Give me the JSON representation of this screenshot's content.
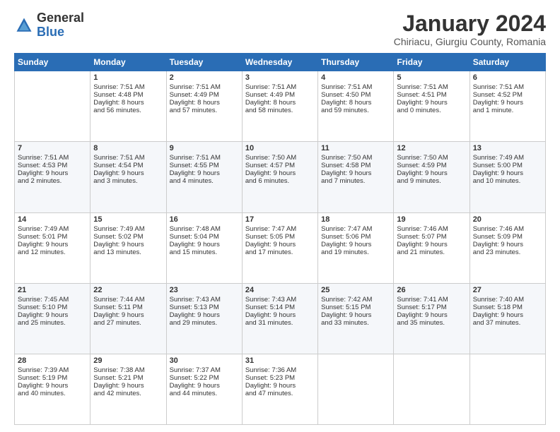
{
  "header": {
    "logo_general": "General",
    "logo_blue": "Blue",
    "main_title": "January 2024",
    "subtitle": "Chiriacu, Giurgiu County, Romania"
  },
  "weekdays": [
    "Sunday",
    "Monday",
    "Tuesday",
    "Wednesday",
    "Thursday",
    "Friday",
    "Saturday"
  ],
  "weeks": [
    [
      {
        "day": "",
        "lines": []
      },
      {
        "day": "1",
        "lines": [
          "Sunrise: 7:51 AM",
          "Sunset: 4:48 PM",
          "Daylight: 8 hours",
          "and 56 minutes."
        ]
      },
      {
        "day": "2",
        "lines": [
          "Sunrise: 7:51 AM",
          "Sunset: 4:49 PM",
          "Daylight: 8 hours",
          "and 57 minutes."
        ]
      },
      {
        "day": "3",
        "lines": [
          "Sunrise: 7:51 AM",
          "Sunset: 4:49 PM",
          "Daylight: 8 hours",
          "and 58 minutes."
        ]
      },
      {
        "day": "4",
        "lines": [
          "Sunrise: 7:51 AM",
          "Sunset: 4:50 PM",
          "Daylight: 8 hours",
          "and 59 minutes."
        ]
      },
      {
        "day": "5",
        "lines": [
          "Sunrise: 7:51 AM",
          "Sunset: 4:51 PM",
          "Daylight: 9 hours",
          "and 0 minutes."
        ]
      },
      {
        "day": "6",
        "lines": [
          "Sunrise: 7:51 AM",
          "Sunset: 4:52 PM",
          "Daylight: 9 hours",
          "and 1 minute."
        ]
      }
    ],
    [
      {
        "day": "7",
        "lines": [
          "Sunrise: 7:51 AM",
          "Sunset: 4:53 PM",
          "Daylight: 9 hours",
          "and 2 minutes."
        ]
      },
      {
        "day": "8",
        "lines": [
          "Sunrise: 7:51 AM",
          "Sunset: 4:54 PM",
          "Daylight: 9 hours",
          "and 3 minutes."
        ]
      },
      {
        "day": "9",
        "lines": [
          "Sunrise: 7:51 AM",
          "Sunset: 4:55 PM",
          "Daylight: 9 hours",
          "and 4 minutes."
        ]
      },
      {
        "day": "10",
        "lines": [
          "Sunrise: 7:50 AM",
          "Sunset: 4:57 PM",
          "Daylight: 9 hours",
          "and 6 minutes."
        ]
      },
      {
        "day": "11",
        "lines": [
          "Sunrise: 7:50 AM",
          "Sunset: 4:58 PM",
          "Daylight: 9 hours",
          "and 7 minutes."
        ]
      },
      {
        "day": "12",
        "lines": [
          "Sunrise: 7:50 AM",
          "Sunset: 4:59 PM",
          "Daylight: 9 hours",
          "and 9 minutes."
        ]
      },
      {
        "day": "13",
        "lines": [
          "Sunrise: 7:49 AM",
          "Sunset: 5:00 PM",
          "Daylight: 9 hours",
          "and 10 minutes."
        ]
      }
    ],
    [
      {
        "day": "14",
        "lines": [
          "Sunrise: 7:49 AM",
          "Sunset: 5:01 PM",
          "Daylight: 9 hours",
          "and 12 minutes."
        ]
      },
      {
        "day": "15",
        "lines": [
          "Sunrise: 7:49 AM",
          "Sunset: 5:02 PM",
          "Daylight: 9 hours",
          "and 13 minutes."
        ]
      },
      {
        "day": "16",
        "lines": [
          "Sunrise: 7:48 AM",
          "Sunset: 5:04 PM",
          "Daylight: 9 hours",
          "and 15 minutes."
        ]
      },
      {
        "day": "17",
        "lines": [
          "Sunrise: 7:47 AM",
          "Sunset: 5:05 PM",
          "Daylight: 9 hours",
          "and 17 minutes."
        ]
      },
      {
        "day": "18",
        "lines": [
          "Sunrise: 7:47 AM",
          "Sunset: 5:06 PM",
          "Daylight: 9 hours",
          "and 19 minutes."
        ]
      },
      {
        "day": "19",
        "lines": [
          "Sunrise: 7:46 AM",
          "Sunset: 5:07 PM",
          "Daylight: 9 hours",
          "and 21 minutes."
        ]
      },
      {
        "day": "20",
        "lines": [
          "Sunrise: 7:46 AM",
          "Sunset: 5:09 PM",
          "Daylight: 9 hours",
          "and 23 minutes."
        ]
      }
    ],
    [
      {
        "day": "21",
        "lines": [
          "Sunrise: 7:45 AM",
          "Sunset: 5:10 PM",
          "Daylight: 9 hours",
          "and 25 minutes."
        ]
      },
      {
        "day": "22",
        "lines": [
          "Sunrise: 7:44 AM",
          "Sunset: 5:11 PM",
          "Daylight: 9 hours",
          "and 27 minutes."
        ]
      },
      {
        "day": "23",
        "lines": [
          "Sunrise: 7:43 AM",
          "Sunset: 5:13 PM",
          "Daylight: 9 hours",
          "and 29 minutes."
        ]
      },
      {
        "day": "24",
        "lines": [
          "Sunrise: 7:43 AM",
          "Sunset: 5:14 PM",
          "Daylight: 9 hours",
          "and 31 minutes."
        ]
      },
      {
        "day": "25",
        "lines": [
          "Sunrise: 7:42 AM",
          "Sunset: 5:15 PM",
          "Daylight: 9 hours",
          "and 33 minutes."
        ]
      },
      {
        "day": "26",
        "lines": [
          "Sunrise: 7:41 AM",
          "Sunset: 5:17 PM",
          "Daylight: 9 hours",
          "and 35 minutes."
        ]
      },
      {
        "day": "27",
        "lines": [
          "Sunrise: 7:40 AM",
          "Sunset: 5:18 PM",
          "Daylight: 9 hours",
          "and 37 minutes."
        ]
      }
    ],
    [
      {
        "day": "28",
        "lines": [
          "Sunrise: 7:39 AM",
          "Sunset: 5:19 PM",
          "Daylight: 9 hours",
          "and 40 minutes."
        ]
      },
      {
        "day": "29",
        "lines": [
          "Sunrise: 7:38 AM",
          "Sunset: 5:21 PM",
          "Daylight: 9 hours",
          "and 42 minutes."
        ]
      },
      {
        "day": "30",
        "lines": [
          "Sunrise: 7:37 AM",
          "Sunset: 5:22 PM",
          "Daylight: 9 hours",
          "and 44 minutes."
        ]
      },
      {
        "day": "31",
        "lines": [
          "Sunrise: 7:36 AM",
          "Sunset: 5:23 PM",
          "Daylight: 9 hours",
          "and 47 minutes."
        ]
      },
      {
        "day": "",
        "lines": []
      },
      {
        "day": "",
        "lines": []
      },
      {
        "day": "",
        "lines": []
      }
    ]
  ]
}
